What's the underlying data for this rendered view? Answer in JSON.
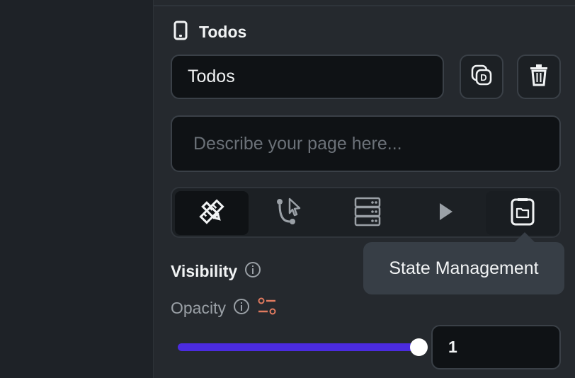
{
  "page": {
    "title": "Todos",
    "name_value": "Todos",
    "description_placeholder": "Describe your page here..."
  },
  "icons": {
    "page_type": "phone-icon",
    "duplicate": "duplicate-icon",
    "delete": "trash-icon"
  },
  "tabs": [
    {
      "id": "properties",
      "icon": "ruler-pencil-icon",
      "active": true
    },
    {
      "id": "actions",
      "icon": "action-flow-icon",
      "active": false
    },
    {
      "id": "backend-query",
      "icon": "database-icon",
      "active": false
    },
    {
      "id": "animations",
      "icon": "play-icon",
      "active": false
    },
    {
      "id": "state-management",
      "icon": "folder-page-icon",
      "active": false,
      "hovered": true
    }
  ],
  "tooltip": {
    "text": "State Management"
  },
  "visibility": {
    "title": "Visibility"
  },
  "opacity": {
    "label": "Opacity",
    "value": "1",
    "slider_fraction": 1.0
  },
  "colors": {
    "slider_fill": "#4b2be0",
    "accent_icon": "#e07a5f",
    "panel_bg": "#25292e"
  }
}
